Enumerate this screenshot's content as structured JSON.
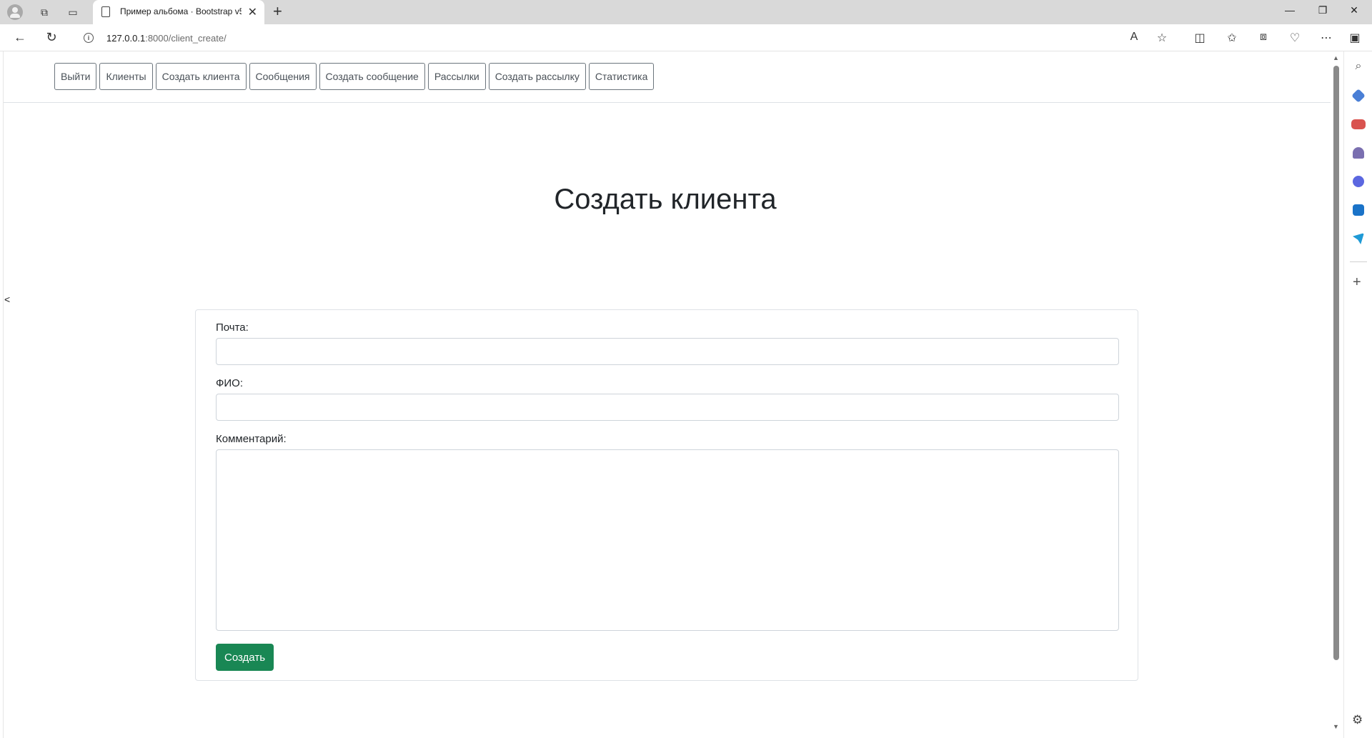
{
  "browser": {
    "tab_title": "Пример альбома · Bootstrap v5.",
    "url_host": "127.0.0.1",
    "url_rest": ":8000/client_create/",
    "new_tab_symbol": "+",
    "close_tab_symbol": "✕",
    "window_controls": [
      "—",
      "❐",
      "✕"
    ]
  },
  "nav": {
    "items": [
      {
        "label": "Выйти"
      },
      {
        "label": "Клиенты"
      },
      {
        "label": "Создать клиента"
      },
      {
        "label": "Сообщения"
      },
      {
        "label": "Создать сообщение"
      },
      {
        "label": "Рассылки"
      },
      {
        "label": "Создать рассылку"
      },
      {
        "label": "Статистика"
      }
    ]
  },
  "page": {
    "title": "Создать клиента",
    "collapse_symbol": "<"
  },
  "form": {
    "email_label": "Почта:",
    "email_value": "",
    "name_label": "ФИО:",
    "name_value": "",
    "comment_label": "Комментарий:",
    "comment_value": "",
    "submit_label": "Создать"
  },
  "colors": {
    "submit_bg": "#198754",
    "nav_border": "#6c757d",
    "tabbar_bg": "#d9d9d9"
  },
  "icons": {
    "sidebar": [
      "search-icon",
      "tag-icon",
      "toolbox-icon",
      "chess-icon",
      "copilot-icon",
      "outlook-icon",
      "send-icon"
    ]
  }
}
